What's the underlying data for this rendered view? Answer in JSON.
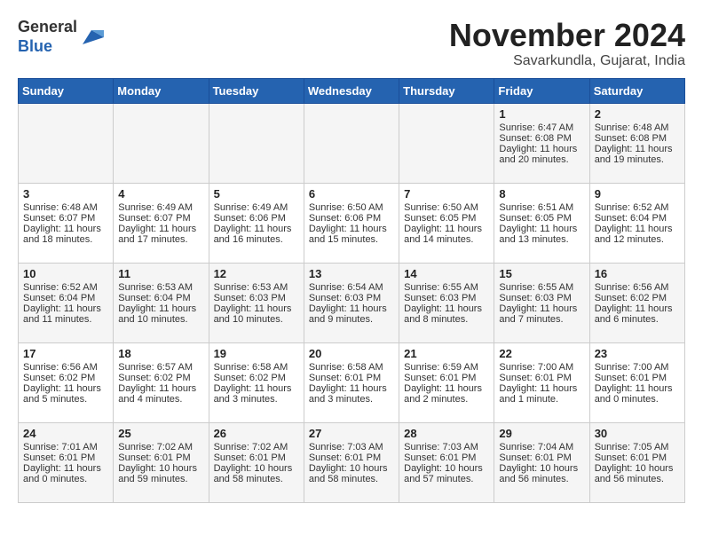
{
  "header": {
    "logo_line1": "General",
    "logo_line2": "Blue",
    "month": "November 2024",
    "location": "Savarkundla, Gujarat, India"
  },
  "weekdays": [
    "Sunday",
    "Monday",
    "Tuesday",
    "Wednesday",
    "Thursday",
    "Friday",
    "Saturday"
  ],
  "weeks": [
    [
      {
        "day": "",
        "info": ""
      },
      {
        "day": "",
        "info": ""
      },
      {
        "day": "",
        "info": ""
      },
      {
        "day": "",
        "info": ""
      },
      {
        "day": "",
        "info": ""
      },
      {
        "day": "1",
        "info": "Sunrise: 6:47 AM\nSunset: 6:08 PM\nDaylight: 11 hours\nand 20 minutes."
      },
      {
        "day": "2",
        "info": "Sunrise: 6:48 AM\nSunset: 6:08 PM\nDaylight: 11 hours\nand 19 minutes."
      }
    ],
    [
      {
        "day": "3",
        "info": "Sunrise: 6:48 AM\nSunset: 6:07 PM\nDaylight: 11 hours\nand 18 minutes."
      },
      {
        "day": "4",
        "info": "Sunrise: 6:49 AM\nSunset: 6:07 PM\nDaylight: 11 hours\nand 17 minutes."
      },
      {
        "day": "5",
        "info": "Sunrise: 6:49 AM\nSunset: 6:06 PM\nDaylight: 11 hours\nand 16 minutes."
      },
      {
        "day": "6",
        "info": "Sunrise: 6:50 AM\nSunset: 6:06 PM\nDaylight: 11 hours\nand 15 minutes."
      },
      {
        "day": "7",
        "info": "Sunrise: 6:50 AM\nSunset: 6:05 PM\nDaylight: 11 hours\nand 14 minutes."
      },
      {
        "day": "8",
        "info": "Sunrise: 6:51 AM\nSunset: 6:05 PM\nDaylight: 11 hours\nand 13 minutes."
      },
      {
        "day": "9",
        "info": "Sunrise: 6:52 AM\nSunset: 6:04 PM\nDaylight: 11 hours\nand 12 minutes."
      }
    ],
    [
      {
        "day": "10",
        "info": "Sunrise: 6:52 AM\nSunset: 6:04 PM\nDaylight: 11 hours\nand 11 minutes."
      },
      {
        "day": "11",
        "info": "Sunrise: 6:53 AM\nSunset: 6:04 PM\nDaylight: 11 hours\nand 10 minutes."
      },
      {
        "day": "12",
        "info": "Sunrise: 6:53 AM\nSunset: 6:03 PM\nDaylight: 11 hours\nand 10 minutes."
      },
      {
        "day": "13",
        "info": "Sunrise: 6:54 AM\nSunset: 6:03 PM\nDaylight: 11 hours\nand 9 minutes."
      },
      {
        "day": "14",
        "info": "Sunrise: 6:55 AM\nSunset: 6:03 PM\nDaylight: 11 hours\nand 8 minutes."
      },
      {
        "day": "15",
        "info": "Sunrise: 6:55 AM\nSunset: 6:03 PM\nDaylight: 11 hours\nand 7 minutes."
      },
      {
        "day": "16",
        "info": "Sunrise: 6:56 AM\nSunset: 6:02 PM\nDaylight: 11 hours\nand 6 minutes."
      }
    ],
    [
      {
        "day": "17",
        "info": "Sunrise: 6:56 AM\nSunset: 6:02 PM\nDaylight: 11 hours\nand 5 minutes."
      },
      {
        "day": "18",
        "info": "Sunrise: 6:57 AM\nSunset: 6:02 PM\nDaylight: 11 hours\nand 4 minutes."
      },
      {
        "day": "19",
        "info": "Sunrise: 6:58 AM\nSunset: 6:02 PM\nDaylight: 11 hours\nand 3 minutes."
      },
      {
        "day": "20",
        "info": "Sunrise: 6:58 AM\nSunset: 6:01 PM\nDaylight: 11 hours\nand 3 minutes."
      },
      {
        "day": "21",
        "info": "Sunrise: 6:59 AM\nSunset: 6:01 PM\nDaylight: 11 hours\nand 2 minutes."
      },
      {
        "day": "22",
        "info": "Sunrise: 7:00 AM\nSunset: 6:01 PM\nDaylight: 11 hours\nand 1 minute."
      },
      {
        "day": "23",
        "info": "Sunrise: 7:00 AM\nSunset: 6:01 PM\nDaylight: 11 hours\nand 0 minutes."
      }
    ],
    [
      {
        "day": "24",
        "info": "Sunrise: 7:01 AM\nSunset: 6:01 PM\nDaylight: 11 hours\nand 0 minutes."
      },
      {
        "day": "25",
        "info": "Sunrise: 7:02 AM\nSunset: 6:01 PM\nDaylight: 10 hours\nand 59 minutes."
      },
      {
        "day": "26",
        "info": "Sunrise: 7:02 AM\nSunset: 6:01 PM\nDaylight: 10 hours\nand 58 minutes."
      },
      {
        "day": "27",
        "info": "Sunrise: 7:03 AM\nSunset: 6:01 PM\nDaylight: 10 hours\nand 58 minutes."
      },
      {
        "day": "28",
        "info": "Sunrise: 7:03 AM\nSunset: 6:01 PM\nDaylight: 10 hours\nand 57 minutes."
      },
      {
        "day": "29",
        "info": "Sunrise: 7:04 AM\nSunset: 6:01 PM\nDaylight: 10 hours\nand 56 minutes."
      },
      {
        "day": "30",
        "info": "Sunrise: 7:05 AM\nSunset: 6:01 PM\nDaylight: 10 hours\nand 56 minutes."
      }
    ]
  ]
}
